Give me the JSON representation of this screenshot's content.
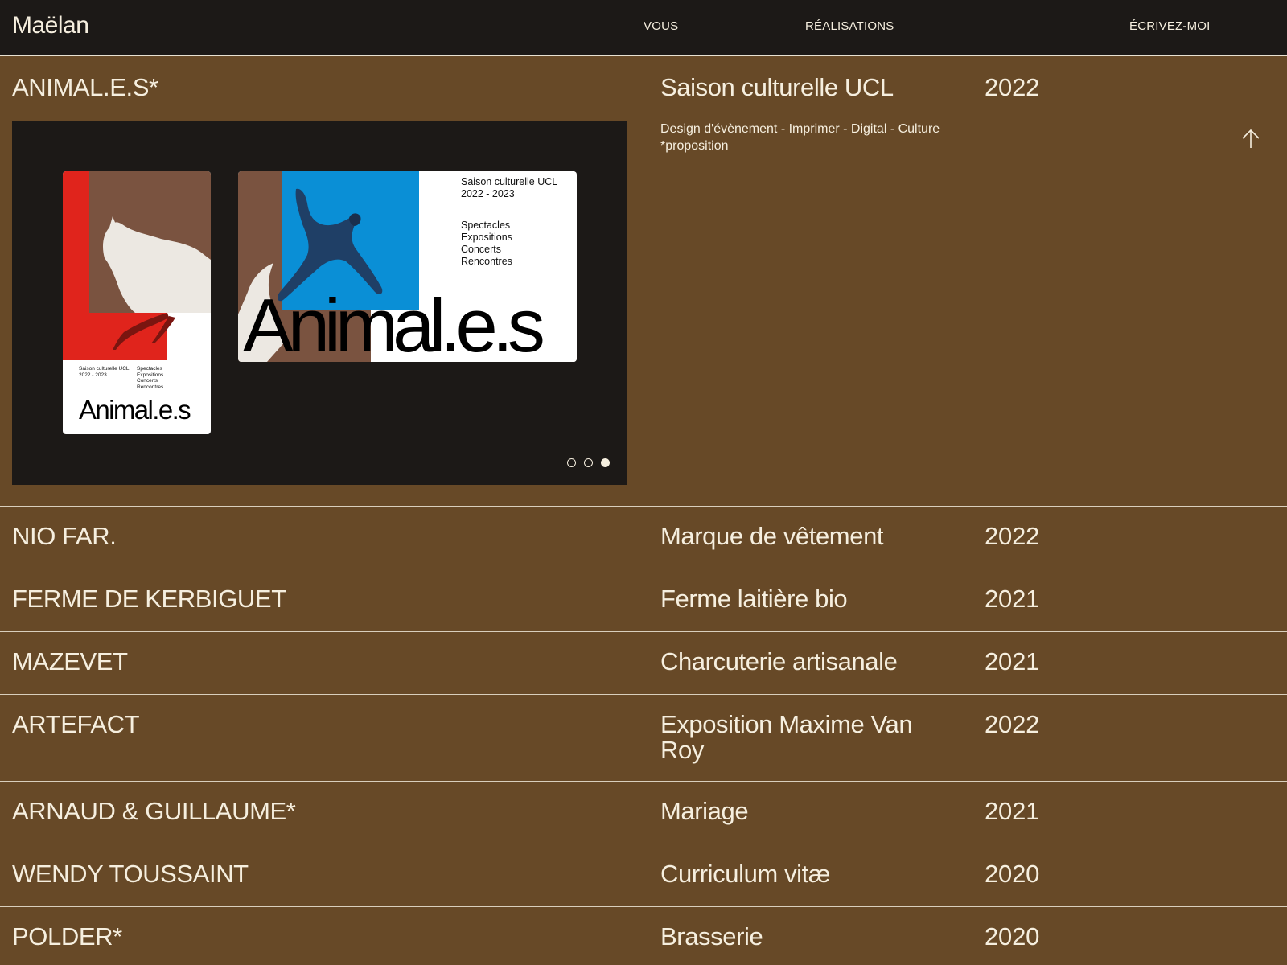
{
  "header": {
    "brand": "Maëlan",
    "nav": [
      {
        "label": "VOUS"
      },
      {
        "label": "RÉALISATIONS"
      },
      {
        "label": "ÉCRIVEZ-MOI"
      }
    ]
  },
  "expanded_project": {
    "name": "ANIMAL.E.S*",
    "description": "Saison culturelle UCL",
    "year": "2022",
    "tags": "Design d'évènement - Imprimer - Digital - Culture",
    "note": "*proposition",
    "collapse_icon": "arrow-up-icon",
    "carousel": {
      "poster": {
        "info_line1": "Saison culturelle UCL",
        "info_line2": "2022 - 2023",
        "list": [
          "Spectacles",
          "Expositions",
          "Concerts",
          "Rencontres"
        ],
        "title": "Animal.e.s"
      },
      "banner": {
        "info_line1": "Saison culturelle UCL",
        "info_line2": "2022 - 2023",
        "list": [
          "Spectacles",
          "Expositions",
          "Concerts",
          "Rencontres"
        ],
        "title": "Animal.e.s"
      },
      "slide_count": 3,
      "active_slide": 3,
      "colors": {
        "red": "#e0241c",
        "blue": "#0a8fd6",
        "brown": "#7a5340",
        "dark": "#1c1917"
      }
    }
  },
  "projects": [
    {
      "name": "NIO FAR.",
      "description": "Marque de vêtement",
      "year": "2022"
    },
    {
      "name": "FERME DE KERBIGUET",
      "description": "Ferme laitière bio",
      "year": "2021"
    },
    {
      "name": "MAZEVET",
      "description": "Charcuterie artisanale",
      "year": "2021"
    },
    {
      "name": "ARTEFACT",
      "description": "Exposition Maxime Van Roy",
      "year": "2022"
    },
    {
      "name": "ARNAUD & GUILLAUME*",
      "description": "Mariage",
      "year": "2021"
    },
    {
      "name": "WENDY TOUSSAINT",
      "description": "Curriculum vitæ",
      "year": "2020"
    },
    {
      "name": "POLDER*",
      "description": "Brasserie",
      "year": "2020"
    }
  ],
  "colors": {
    "background": "#674927",
    "header": "#1c1917",
    "text": "#f6efdf"
  }
}
